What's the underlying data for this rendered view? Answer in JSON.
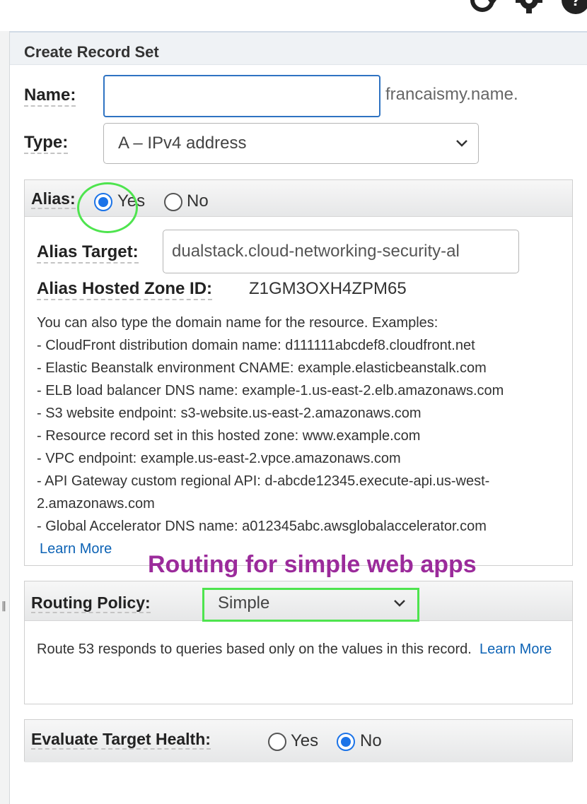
{
  "toolbar": {
    "icons": [
      "refresh-icon",
      "gear-icon",
      "help-icon"
    ]
  },
  "panel": {
    "title": "Create Record Set"
  },
  "form": {
    "name_label": "Name:",
    "name_value": "",
    "domain_suffix": "francaismy.name.",
    "type_label": "Type:",
    "type_value": "A – IPv4 address"
  },
  "alias": {
    "label": "Alias:",
    "options": {
      "yes": "Yes",
      "no": "No"
    },
    "selected": "Yes",
    "target_label": "Alias Target:",
    "target_value": "dualstack.cloud-networking-security-al",
    "hosted_zone_label": "Alias Hosted Zone ID:",
    "hosted_zone_value": "Z1GM3OXH4ZPM65",
    "help_intro": "You can also type the domain name for the resource. Examples:",
    "help_items": [
      "-  CloudFront distribution domain name: d111111abcdef8.cloudfront.net",
      "-  Elastic Beanstalk environment CNAME: example.elasticbeanstalk.com",
      "-  ELB load balancer DNS name: example-1.us-east-2.elb.amazonaws.com",
      "-  S3 website endpoint: s3-website.us-east-2.amazonaws.com",
      "-  Resource record set in this hosted zone: www.example.com",
      "-  VPC endpoint: example.us-east-2.vpce.amazonaws.com",
      "-  API Gateway custom regional API: d-abcde12345.execute-api.us-west-",
      "2.amazonaws.com",
      "-  Global Accelerator DNS name: a012345abc.awsglobalaccelerator.com"
    ],
    "learn_more": "Learn More"
  },
  "annotation": {
    "text": "Routing for simple web apps",
    "color": "#9b2b9b"
  },
  "routing": {
    "label": "Routing Policy:",
    "value": "Simple",
    "description": "Route 53 responds to queries based only on the values in this record.",
    "learn_more": "Learn More"
  },
  "health": {
    "label": "Evaluate Target Health:",
    "options": {
      "yes": "Yes",
      "no": "No"
    },
    "selected": "No"
  },
  "colors": {
    "accent": "#1b73e8",
    "link": "#0d63b5",
    "highlight": "#4ee44e"
  }
}
